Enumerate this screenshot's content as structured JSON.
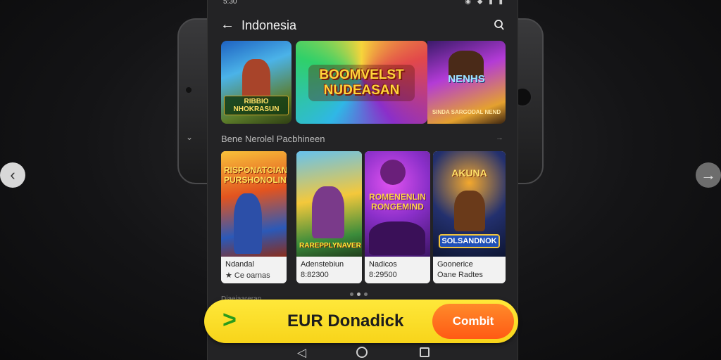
{
  "status": {
    "time": "5:30",
    "icons": "◉ ◆ ▮ ▮"
  },
  "header": {
    "title": "Indonesia"
  },
  "banners": [
    {
      "text": "RIBBIO NHOKRASUN"
    },
    {
      "text": "BOOMVELST NUDEASAN"
    },
    {
      "text": "NENHS",
      "sub": "SINDA SARGODAL NEND"
    }
  ],
  "section": {
    "title": "Bene Nerolel Pacbhineen",
    "more": "→"
  },
  "cards": [
    {
      "logo": "RISPONATCIAN PURSHONOLIN",
      "name": "Ndandal",
      "sub": "★ Ce oarnas"
    },
    {
      "logo": "RAREPPLYNAVER",
      "name": "Adenstebiun",
      "sub": "8:82300"
    },
    {
      "logo": "ROMENENLIN RONGEMIND",
      "name": "Nadicos",
      "sub": "8:29500"
    },
    {
      "logo": "AKUNA",
      "logo2": "SOLSANDNOK",
      "name": "Goonerice",
      "sub": "Oane Radtes"
    }
  ],
  "section2": {
    "title": "Diaeiaareran"
  },
  "cta": {
    "arrow": ">",
    "label": "EUR Donadick",
    "submit": "Combit"
  },
  "colors": {
    "accent": "#ffe83a",
    "submit": "#ff6a1a",
    "arrow": "#2a9b1c"
  }
}
